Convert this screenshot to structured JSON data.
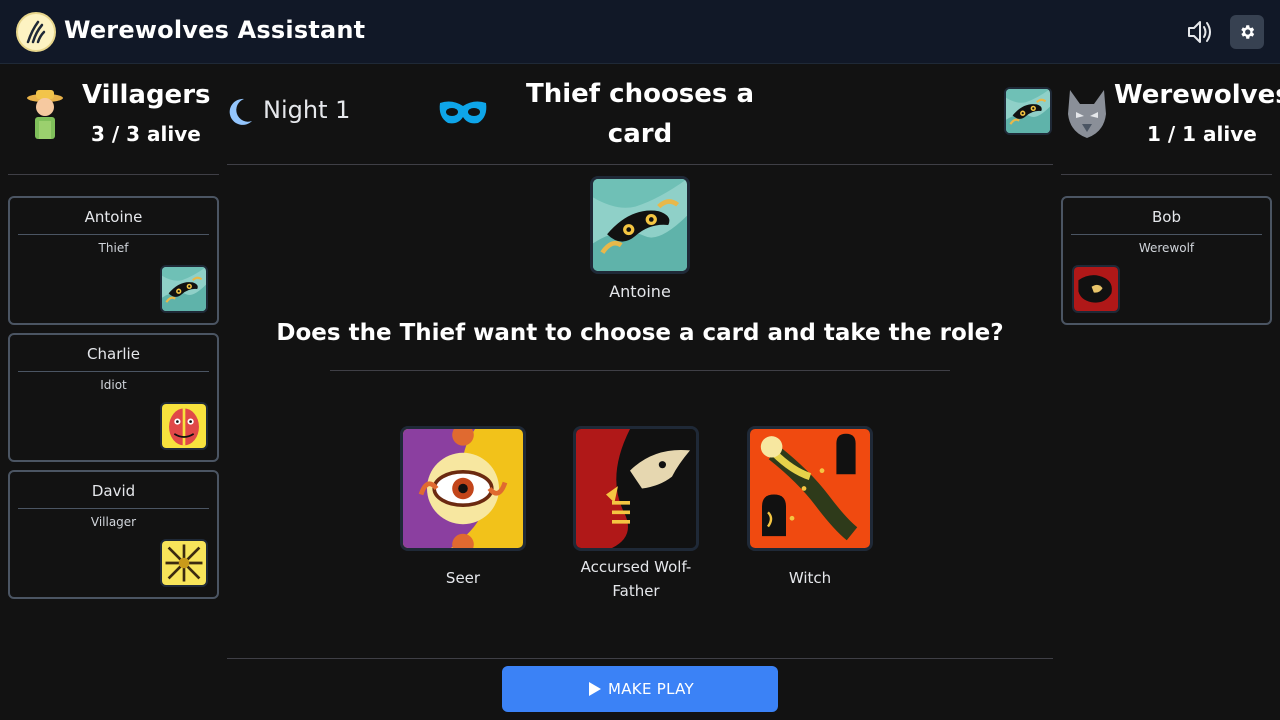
{
  "app": {
    "title": "Werewolves Assistant"
  },
  "villagers": {
    "name": "Villagers",
    "alive": "3 / 3 alive",
    "players": [
      {
        "name": "Antoine",
        "role": "Thief"
      },
      {
        "name": "Charlie",
        "role": "Idiot"
      },
      {
        "name": "David",
        "role": "Villager"
      }
    ]
  },
  "werewolves": {
    "name": "Werewolves",
    "alive": "1 / 1 alive",
    "players": [
      {
        "name": "Bob",
        "role": "Werewolf"
      }
    ]
  },
  "game": {
    "phase": "Night 1",
    "step_title": "Thief chooses a card",
    "current_player": "Antoine",
    "question": "Does the Thief want to choose a card and take the role?",
    "choices": [
      {
        "label": "Seer"
      },
      {
        "label": "Accursed Wolf-Father"
      },
      {
        "label": "Witch"
      }
    ],
    "play_button": "MAKE PLAY"
  },
  "colors": {
    "background": "#121212",
    "header": "#111827",
    "accent_button": "#3b82f6",
    "mask_icon": "#0ea5e9",
    "moon_icon": "#93c5fd"
  }
}
